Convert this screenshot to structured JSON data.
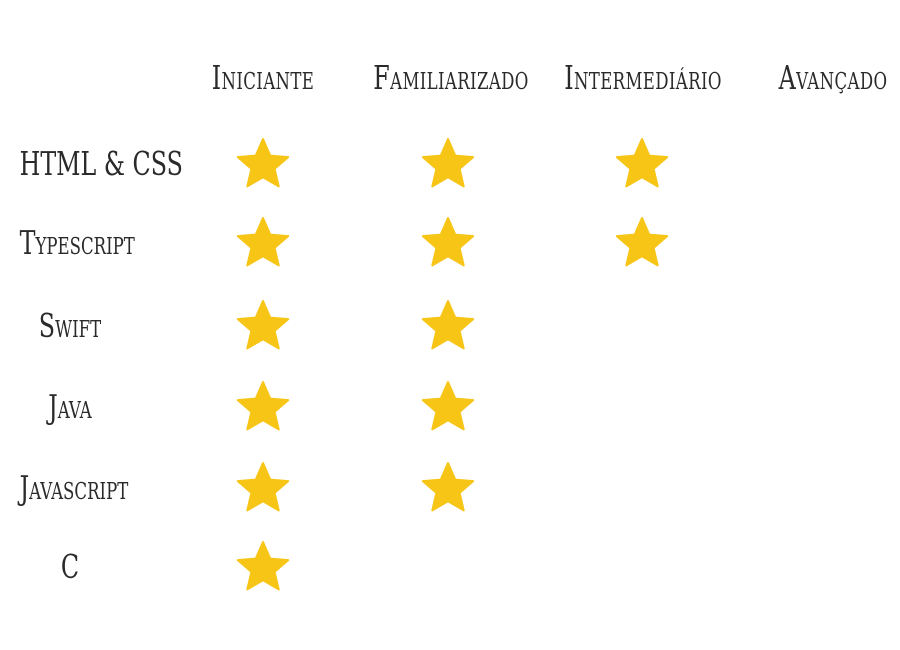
{
  "levels": [
    "Iniciante",
    "Familiarizado",
    "Intermediário",
    "Avançado"
  ],
  "skills": [
    {
      "name": "HTML & CSS",
      "stars": 3
    },
    {
      "name": "Typescript",
      "stars": 3
    },
    {
      "name": "Swift",
      "stars": 2
    },
    {
      "name": "Java",
      "stars": 2
    },
    {
      "name": "Javascript",
      "stars": 2
    },
    {
      "name": "C",
      "stars": 1
    }
  ],
  "colors": {
    "star": "#F7C516",
    "text": "#2a2a2a",
    "background": "#ffffff"
  },
  "icons": {
    "star": "star-icon"
  }
}
